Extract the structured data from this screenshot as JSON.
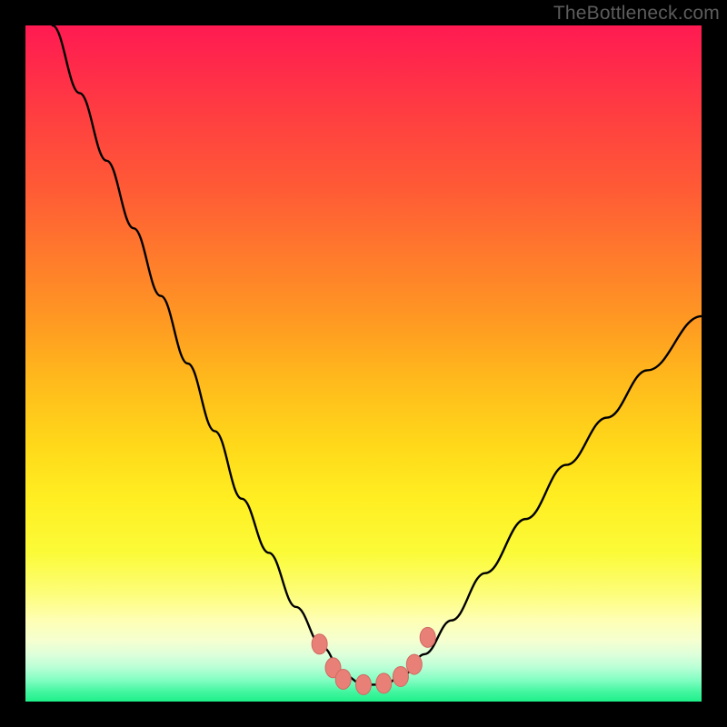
{
  "watermark": "TheBottleneck.com",
  "chart_data": {
    "type": "line",
    "title": "",
    "xlabel": "",
    "ylabel": "",
    "series": [
      {
        "name": "bottleneck-curve",
        "x": [
          0.04,
          0.08,
          0.12,
          0.16,
          0.2,
          0.24,
          0.28,
          0.32,
          0.36,
          0.4,
          0.44,
          0.47,
          0.5,
          0.53,
          0.56,
          0.59,
          0.63,
          0.68,
          0.74,
          0.8,
          0.86,
          0.92,
          1.0
        ],
        "y": [
          1.0,
          0.9,
          0.8,
          0.7,
          0.6,
          0.5,
          0.4,
          0.3,
          0.22,
          0.14,
          0.08,
          0.04,
          0.025,
          0.025,
          0.04,
          0.07,
          0.12,
          0.19,
          0.27,
          0.35,
          0.42,
          0.49,
          0.57
        ]
      }
    ],
    "markers": {
      "name": "points-in-valley",
      "x": [
        0.435,
        0.455,
        0.47,
        0.5,
        0.53,
        0.555,
        0.575,
        0.595
      ],
      "y": [
        0.085,
        0.05,
        0.033,
        0.025,
        0.027,
        0.037,
        0.055,
        0.095
      ]
    },
    "xlim": [
      0,
      1
    ],
    "ylim": [
      0,
      1
    ],
    "grid": false,
    "legend": false
  },
  "colors": {
    "curve_stroke": "#000000",
    "marker_fill": "#e98077",
    "marker_stroke": "#cf6b63"
  }
}
